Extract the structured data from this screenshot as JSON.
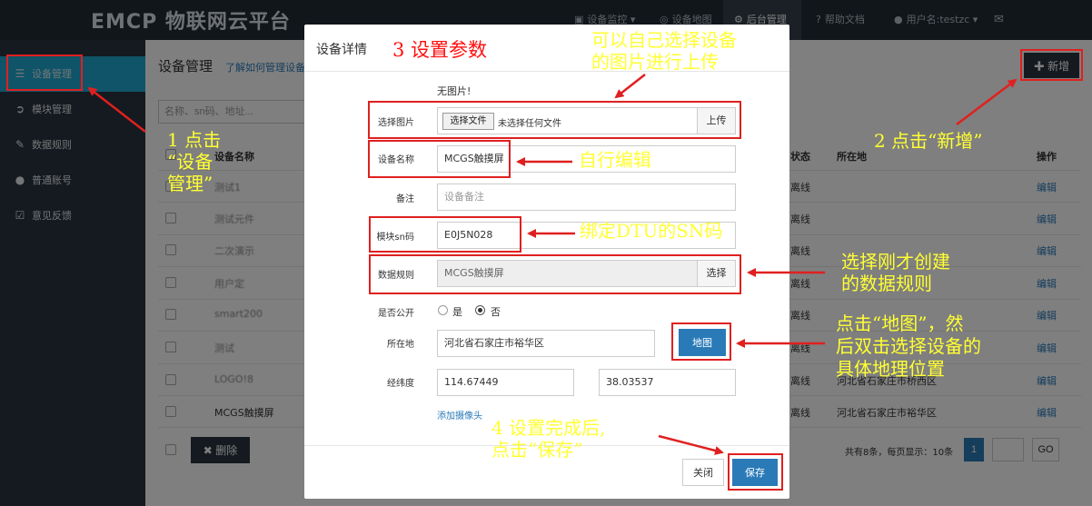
{
  "topbar": {
    "logo_text": "EMCP 物联网云平台",
    "nav": {
      "monitor": "设备监控",
      "map": "设备地图",
      "admin": "后台管理",
      "help": "帮助文档",
      "user": "用户名:testzc"
    }
  },
  "sidebar": {
    "items": [
      {
        "label": "设备管理",
        "icon": "list-icon"
      },
      {
        "label": "模块管理",
        "icon": "sign-in-icon"
      },
      {
        "label": "数据规则",
        "icon": "pencil-icon"
      },
      {
        "label": "普通账号",
        "icon": "user-icon"
      },
      {
        "label": "意见反馈",
        "icon": "edit-icon"
      }
    ]
  },
  "main": {
    "title": "设备管理",
    "help_link": "了解如何管理设备",
    "search_placeholder": "名称、sn码、地址...",
    "add_button": "新增",
    "columns": {
      "name": "设备名称",
      "status": "状态",
      "location": "所在地",
      "action": "操作"
    },
    "rows": [
      {
        "name": "测试1",
        "status": "离线",
        "location": "",
        "action": "编辑"
      },
      {
        "name": "测试元件",
        "status": "离线",
        "location": "",
        "action": "编辑"
      },
      {
        "name": "二次演示",
        "status": "离线",
        "location": "",
        "action": "编辑"
      },
      {
        "name": "用户定",
        "status": "离线",
        "location": "",
        "action": "编辑"
      },
      {
        "name": "smart200",
        "status": "离线",
        "location": "",
        "action": "编辑"
      },
      {
        "name": "测试",
        "status": "离线",
        "location": "",
        "action": "编辑"
      },
      {
        "name": "LOGO!8",
        "status": "离线",
        "location": "河北省石家庄市桥西区",
        "action": "编辑"
      },
      {
        "name": "MCGS触摸屏",
        "status": "离线",
        "location": "河北省石家庄市裕华区",
        "action": "编辑"
      }
    ],
    "delete_button": "删除",
    "pager": {
      "text": "共有8条，每页显示：10条",
      "current_page": "1",
      "go_label": "GO"
    }
  },
  "modal": {
    "title": "设备详情",
    "no_image": "无图片!",
    "fields": {
      "image_label": "选择图片",
      "file_button": "选择文件",
      "file_status": "未选择任何文件",
      "upload_button": "上传",
      "name_label": "设备名称",
      "name_value": "MCGS触摸屏",
      "remark_label": "备注",
      "remark_placeholder": "设备备注",
      "sn_label": "模块sn码",
      "sn_value": "E0J5N028",
      "rule_label": "数据规则",
      "rule_value": "MCGS触摸屏",
      "rule_select_button": "选择",
      "public_label": "是否公开",
      "public_yes": "是",
      "public_no": "否",
      "public_selected": "否",
      "location_label": "所在地",
      "location_value": "河北省石家庄市裕华区",
      "map_button": "地图",
      "coord_label": "经纬度",
      "longitude": "114.67449",
      "latitude": "38.03537",
      "add_camera_link": "添加摄像头"
    },
    "close_button": "关闭",
    "save_button": "保存"
  },
  "annotations": {
    "step1": [
      "1 点击",
      "“设备",
      "管理”"
    ],
    "step2": "2 点击“新增”",
    "step3": "3 设置参数",
    "step4": [
      "4 设置完成后,",
      "点击“保存”"
    ],
    "upload_note": [
      "可以自己选择设备",
      "的图片进行上传"
    ],
    "edit_note": "自行编辑",
    "sn_note": "绑定DTU的SN码",
    "rule_note": [
      "选择刚才创建",
      "的数据规则"
    ],
    "map_note": [
      "点击“地图”，然",
      "后双击选择设备的",
      "具体地理位置"
    ]
  },
  "colors": {
    "topbar_bg": "#232c36",
    "sidebar_bg": "#2a3440",
    "sidebar_active": "#1ea8d1",
    "primary_button": "#2a7ab8",
    "annotation_yellow": "#ffff33",
    "annotation_red": "#e02020"
  }
}
